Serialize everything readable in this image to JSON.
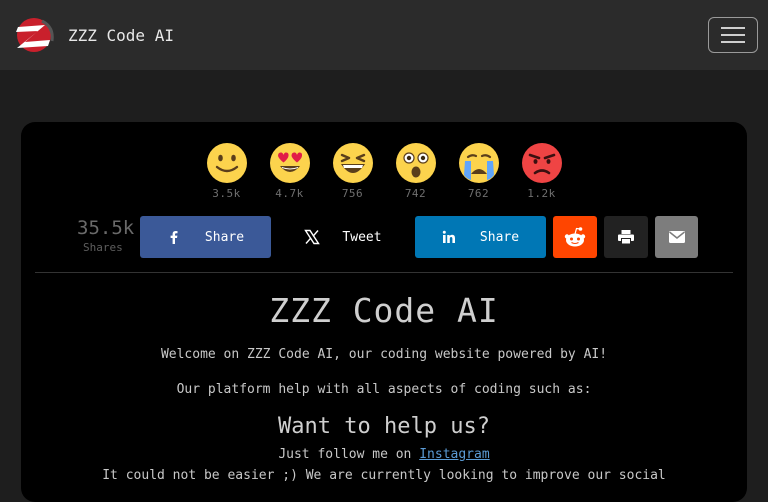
{
  "navbar": {
    "brand": "ZZZ Code AI",
    "brand_logo": "z-logo-icon",
    "toggler_icon": "hamburger-menu-icon"
  },
  "reactions": [
    {
      "icon": "smiling-face-icon",
      "count": "3.5k"
    },
    {
      "icon": "heart-eyes-face-icon",
      "count": "4.7k"
    },
    {
      "icon": "laughing-face-icon",
      "count": "756"
    },
    {
      "icon": "astonished-face-icon",
      "count": "742"
    },
    {
      "icon": "crying-face-icon",
      "count": "762"
    },
    {
      "icon": "angry-face-icon",
      "count": "1.2k"
    }
  ],
  "share": {
    "total": "35.5k",
    "total_label": "Shares",
    "facebook_label": "Share",
    "twitter_label": "Tweet",
    "linkedin_label": "Share",
    "colors": {
      "facebook": "#3b5998",
      "linkedin": "#0077b5",
      "reddit": "#ff4500",
      "email": "#7d7d7d"
    }
  },
  "content": {
    "title": "ZZZ Code AI",
    "welcome": "Welcome on ZZZ Code AI, our coding website powered by AI!",
    "platform": "Our platform help with all aspects of coding such as:",
    "help_heading": "Want to help us?",
    "follow_prefix": "Just follow me on ",
    "follow_link": "Instagram",
    "easier": "It could not be easier ;) We are currently looking to improve our social"
  }
}
